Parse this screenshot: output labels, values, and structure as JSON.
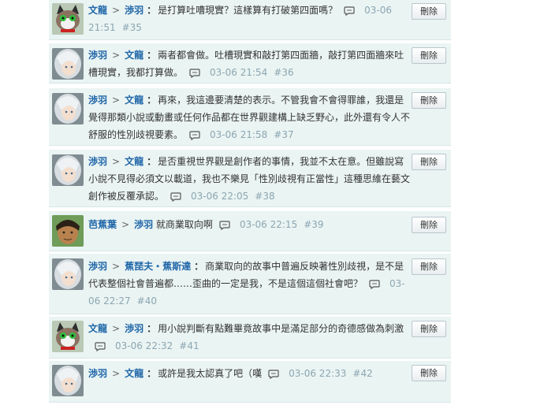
{
  "labels": {
    "arrow": ">",
    "delete": "刪除"
  },
  "comments": [
    {
      "avatar": "cat",
      "author": "文龍",
      "target": "渉羽",
      "text": "是打算吐嘈現實？這樣算有打破第四面嗎？",
      "time": "03-06 21:51",
      "num": "#35"
    },
    {
      "avatar": "silver",
      "author": "渉羽",
      "target": "文龍",
      "text": "兩者都會做。吐槽現實和敲打第四面牆，敲打第四面牆來吐槽現實，我都打算做。",
      "time": "03-06 21:54",
      "num": "#36"
    },
    {
      "avatar": "silver",
      "author": "渉羽",
      "target": "文龍",
      "text": "再來，我這邊要清楚的表示。不管我會不會得罪誰，我還是覺得那類小說或動畫或任何作品都在世界觀建構上缺乏野心，此外還有令人不舒服的性別歧視要素。",
      "time": "03-06 21:58",
      "num": "#37"
    },
    {
      "avatar": "silver",
      "author": "渉羽",
      "target": "文龍",
      "text": "是否重視世界觀是創作者的事情，我並不太在意。但雖說寫小說不見得必須文以載道，我也不樂見「性別歧視有正當性」這種思維在藝文創作被反覆承認。",
      "time": "03-06 22:05",
      "num": "#38"
    },
    {
      "avatar": "tan",
      "author": "芭蕉葉",
      "target": "渉羽",
      "text": "就商業取向啊",
      "time": "03-06 22:15",
      "num": "#39",
      "notarget_colon": true
    },
    {
      "avatar": "silver",
      "author": "渉羽",
      "target": "蕉琵夫・蕉斯達",
      "text": "商業取向的故事中普遍反映著性別歧視，是不是代表整個社會普遍都……歪曲的一定是我，不是這個這個社會吧？",
      "time": "03-06 22:27",
      "num": "#40"
    },
    {
      "avatar": "cat",
      "author": "文龍",
      "target": "渉羽",
      "text": "用小說判斷有點難畢竟故事中是滿足部分的奇德感做為刺激",
      "time": "03-06 22:32",
      "num": "#41"
    },
    {
      "avatar": "silver",
      "author": "渉羽",
      "target": "文龍",
      "text": "或許是我太認真了吧（嘆",
      "time": "03-06 22:33",
      "num": "#42"
    }
  ]
}
